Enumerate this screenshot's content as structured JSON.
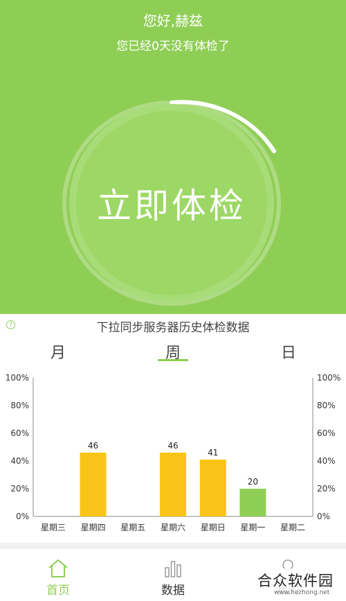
{
  "header": {
    "greeting": "您好,赫兹",
    "subtitle": "您已经0天没有体检了"
  },
  "check_button": {
    "label": "立即体检",
    "progress": 0.15
  },
  "history": {
    "sync_hint": "下拉同步服务器历史体检数据",
    "tabs": [
      "月",
      "周",
      "日"
    ],
    "active_tab": "周"
  },
  "chart_data": {
    "type": "bar",
    "categories": [
      "星期三",
      "星期四",
      "星期五",
      "星期六",
      "星期日",
      "星期一",
      "星期二"
    ],
    "values": [
      0,
      46,
      0,
      46,
      41,
      20,
      0
    ],
    "data_labels": [
      "",
      "46",
      "",
      "46",
      "41",
      "20",
      ""
    ],
    "bar_colors": [
      "#f8c417",
      "#f8c417",
      "#f8c417",
      "#f8c417",
      "#f8c417",
      "#8fce55",
      "#f8c417"
    ],
    "y_ticks": [
      "0%",
      "20%",
      "40%",
      "60%",
      "80%",
      "100%"
    ],
    "ylim": [
      0,
      100
    ],
    "grid": false
  },
  "bottom_nav": [
    {
      "label": "首页",
      "icon": "home-icon",
      "active": true
    },
    {
      "label": "数据",
      "icon": "bar-chart-icon",
      "active": false
    },
    {
      "label": "我的",
      "icon": "user-icon",
      "active": false
    }
  ],
  "watermark": {
    "text": "合众软件园",
    "url": "www.hezhong.net"
  },
  "colors": {
    "accent": "#8fce55",
    "bar": "#f8c417",
    "bar_highlight": "#8fce55"
  }
}
